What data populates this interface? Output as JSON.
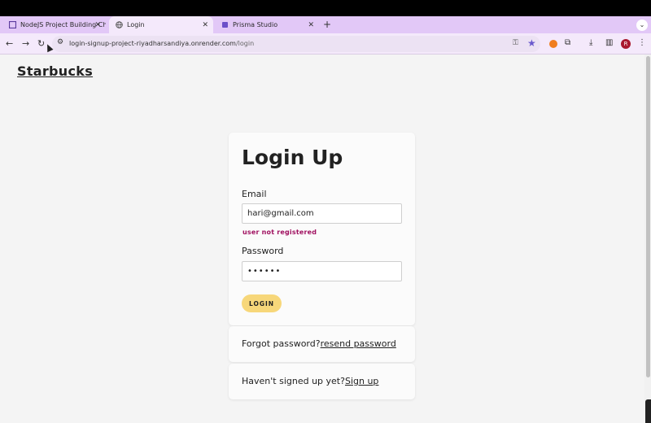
{
  "browser": {
    "tabs": [
      {
        "label": "NodeJS Project Building Chal",
        "active": false
      },
      {
        "label": "Login",
        "active": true
      },
      {
        "label": "Prisma Studio",
        "active": false
      }
    ],
    "url_host": "login-signup-project-riyadharsandiya.onrender.com",
    "url_path": "/login",
    "avatar_letter": "R",
    "accent_color": "#e2c8f7"
  },
  "page": {
    "brand": "Starbucks",
    "form": {
      "title": "Login Up",
      "email_label": "Email",
      "email_value": "hari@gmail.com",
      "error": "user not registered",
      "password_label": "Password",
      "password_value": "••••••",
      "login_button": "LOGIN"
    },
    "forgot": {
      "text": "Forgot password?",
      "link": "resend password"
    },
    "signup": {
      "text": "Haven't signed up yet?",
      "link": "Sign up"
    }
  }
}
